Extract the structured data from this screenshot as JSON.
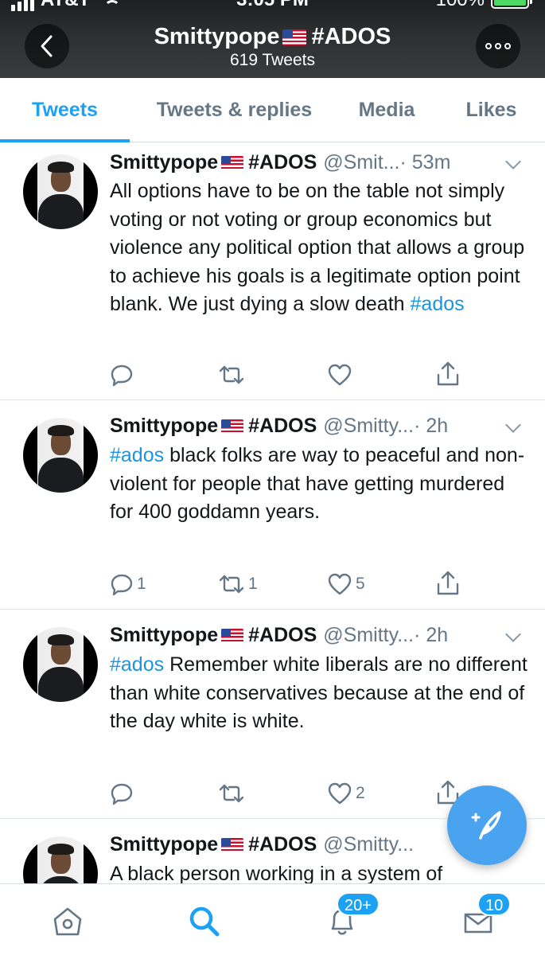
{
  "status_bar": {
    "carrier": "AT&T",
    "time": "3:05 PM",
    "battery": "100%"
  },
  "header": {
    "name": "Smittypope",
    "tag": "#ADOS",
    "tweet_count": "619 Tweets"
  },
  "tabs": [
    "Tweets",
    "Tweets & replies",
    "Media",
    "Likes"
  ],
  "active_tab": "Tweets",
  "tweets": [
    {
      "name": "Smittypope",
      "tag": "#ADOS",
      "handle": "@Smit...",
      "time": "· 53m",
      "text_before": "All options have to be on the table not simply voting or not voting or group economics but violence any political option that allows a group to achieve his goals is a legitimate option point blank. We just dying a slow death ",
      "hashtag": "#ados",
      "text_after": "",
      "replies": "",
      "retweets": "",
      "likes": ""
    },
    {
      "name": "Smittypope",
      "tag": "#ADOS",
      "handle": "@Smitty...",
      "time": "· 2h",
      "hashtag": "#ados",
      "text_after": " black folks are way to peaceful and non-violent for people that have getting murdered for 400 goddamn years.",
      "replies": "1",
      "retweets": "1",
      "likes": "5"
    },
    {
      "name": "Smittypope",
      "tag": "#ADOS",
      "handle": "@Smitty...",
      "time": "· 2h",
      "hashtag": "#ados",
      "text_after": " Remember white liberals are no different than white conservatives because at the end of the day white is white.",
      "replies": "",
      "retweets": "",
      "likes": "2"
    },
    {
      "name": "Smittypope",
      "tag": "#ADOS",
      "handle": "@Smitty...",
      "text": "A black person working in a system of"
    }
  ],
  "bottom_nav": {
    "notifications_badge": "20+",
    "messages_badge": "10"
  },
  "colors": {
    "accent": "#1da1f2",
    "hashtag": "#1b95e0",
    "muted": "#657786",
    "compose": "#4aa3ef"
  }
}
